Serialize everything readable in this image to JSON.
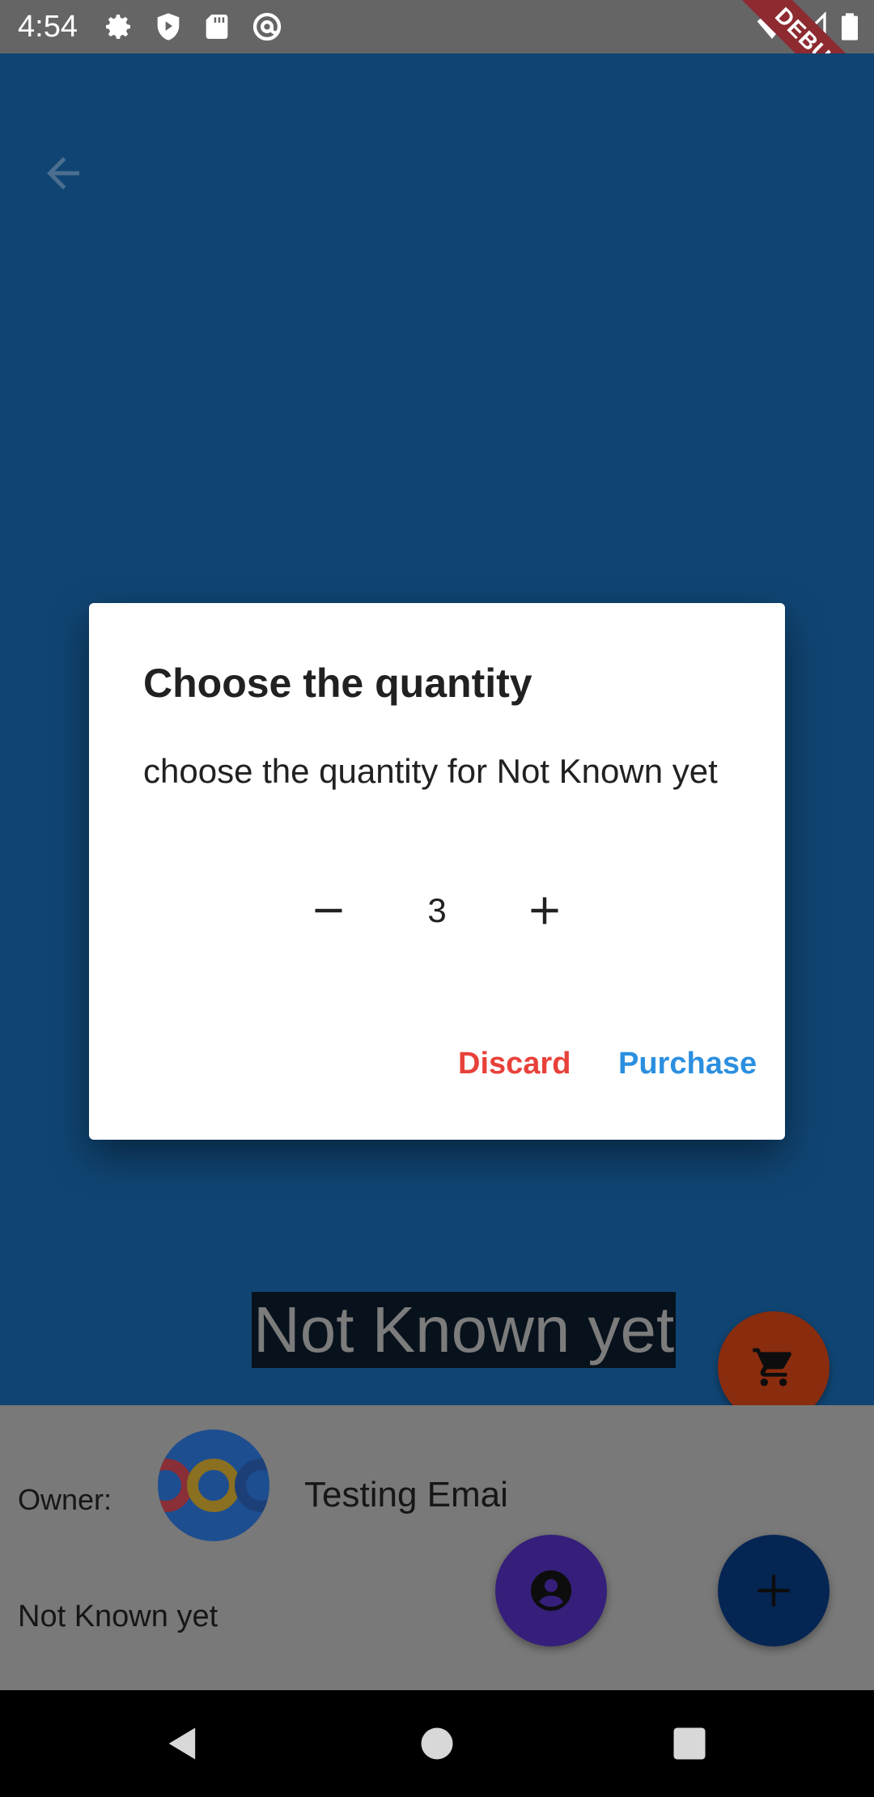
{
  "status_bar": {
    "time": "4:54",
    "left_icons": [
      "gear-icon",
      "shield-play-icon",
      "sd-card-icon",
      "at-sign-icon"
    ],
    "right_icons": [
      "wifi-icon",
      "cell-signal-icon",
      "battery-icon"
    ],
    "debug_banner": "DEBUG"
  },
  "app": {
    "back_icon": "arrow-back-icon",
    "hero_title": "Not Known yet",
    "cart_icon": "cart-icon"
  },
  "owner_panel": {
    "owner_label": "Owner:",
    "owner_name": "Testing Emai",
    "item_name": "Not Known yet",
    "profile_icon": "account-circle-icon",
    "add_icon": "plus-icon"
  },
  "dialog": {
    "title": "Choose the quantity",
    "message": "choose the quantity for Not Known yet",
    "quantity": "3",
    "decrement_icon": "minus-icon",
    "increment_icon": "plus-icon",
    "discard_label": "Discard",
    "purchase_label": "Purchase"
  },
  "colors": {
    "appbar_dimmed": "#104573",
    "discard": "#e8413a",
    "purchase": "#2b8fe0",
    "cart_fab": "#8a2c0e",
    "profile_fab": "#351f7a",
    "add_fab": "#052553"
  },
  "nav_bar": {
    "icons": [
      "nav-back-icon",
      "nav-home-icon",
      "nav-recents-icon"
    ]
  }
}
